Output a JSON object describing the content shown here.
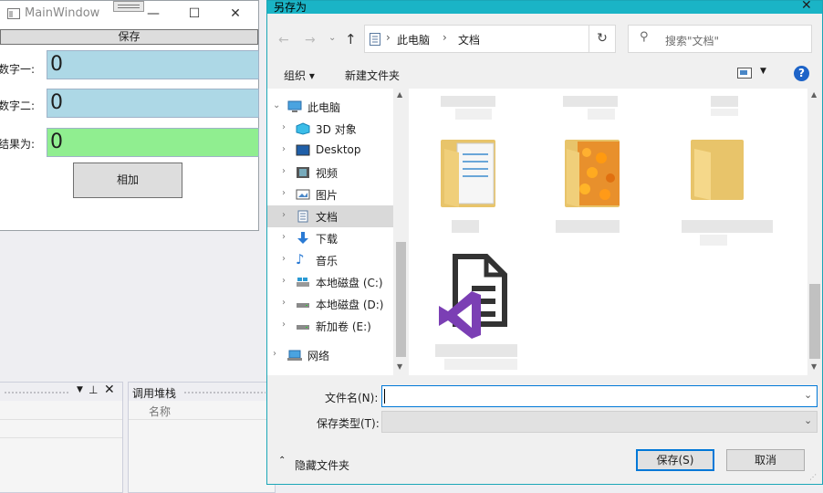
{
  "main_window": {
    "title": "MainWindow",
    "save_label": "保存",
    "fields": [
      {
        "label": "数字一:",
        "value": "0",
        "color": "#add8e6"
      },
      {
        "label": "数字二:",
        "value": "0",
        "color": "#add8e6"
      },
      {
        "label": "结果为:",
        "value": "0",
        "color": "#90ee90"
      }
    ],
    "add_label": "相加"
  },
  "ide": {
    "call_stack_title": "调用堆栈",
    "name_column": "名称"
  },
  "dialog": {
    "title": "另存为",
    "breadcrumb": [
      "此电脑",
      "文档"
    ],
    "search_placeholder": "搜索\"文档\"",
    "toolbar": {
      "organize": "组织 ▾",
      "new_folder": "新建文件夹"
    },
    "tree": [
      {
        "label": "此电脑",
        "icon": "pc-icon",
        "level": 0,
        "expanded": true
      },
      {
        "label": "3D 对象",
        "icon": "3d-objects-icon",
        "level": 1
      },
      {
        "label": "Desktop",
        "icon": "desktop-icon",
        "level": 1
      },
      {
        "label": "视频",
        "icon": "video-icon",
        "level": 1
      },
      {
        "label": "图片",
        "icon": "pictures-icon",
        "level": 1
      },
      {
        "label": "文档",
        "icon": "documents-icon",
        "level": 1,
        "selected": true
      },
      {
        "label": "下载",
        "icon": "downloads-icon",
        "level": 1
      },
      {
        "label": "音乐",
        "icon": "music-icon",
        "level": 1
      },
      {
        "label": "本地磁盘 (C:)",
        "icon": "drive-c-icon",
        "level": 1
      },
      {
        "label": "本地磁盘 (D:)",
        "icon": "drive-icon",
        "level": 1
      },
      {
        "label": "新加卷 (E:)",
        "icon": "drive-icon",
        "level": 1
      },
      {
        "label": "网络",
        "icon": "network-icon",
        "level": 0
      }
    ],
    "filename_label": "文件名(N):",
    "filename_value": "",
    "filetype_label": "保存类型(T):",
    "filetype_value": "",
    "hide_folders": "隐藏文件夹",
    "save_button": "保存(S)",
    "cancel_button": "取消",
    "accent": "#1ab4c6"
  }
}
